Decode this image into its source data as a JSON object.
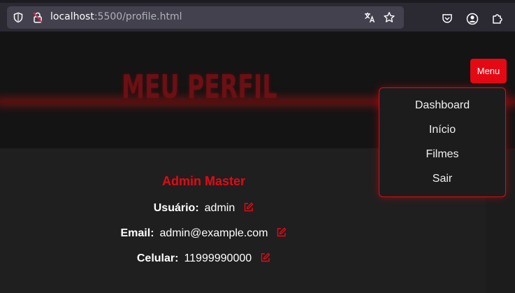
{
  "browser": {
    "url_host": "localhost",
    "url_rest": ":5500/profile.html"
  },
  "hero": {
    "title": "MEU PERFIL"
  },
  "profile": {
    "name": "Admin Master",
    "fields": [
      {
        "label": "Usuário:",
        "value": "admin"
      },
      {
        "label": "Email:",
        "value": "admin@example.com"
      },
      {
        "label": "Celular:",
        "value": "11999990000"
      }
    ]
  },
  "menu": {
    "button_label": "Menu",
    "items": [
      "Dashboard",
      "Início",
      "Filmes",
      "Sair"
    ]
  },
  "colors": {
    "accent": "#e50914",
    "background": "#1f1f1f"
  }
}
